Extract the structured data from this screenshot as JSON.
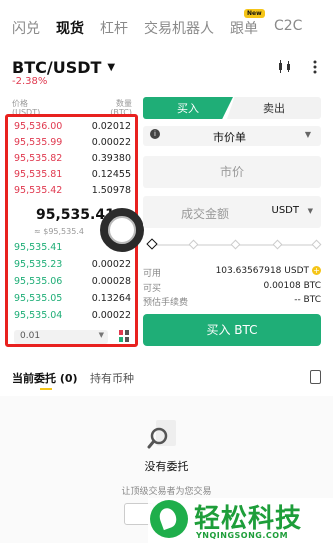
{
  "top_tabs": [
    {
      "label": "闪兑",
      "active": false
    },
    {
      "label": "现货",
      "active": true
    },
    {
      "label": "杠杆",
      "active": false
    },
    {
      "label": "交易机器人",
      "active": false
    },
    {
      "label": "跟单",
      "active": false,
      "badge": "New"
    },
    {
      "label": "C2C",
      "active": false
    }
  ],
  "pair": {
    "name": "BTC/USDT",
    "change": "-2.38%"
  },
  "orderbook": {
    "price_header": "价格",
    "price_unit": "(USDT)",
    "qty_header": "数量",
    "qty_unit": "(BTC)",
    "asks": [
      {
        "price": "95,536.00",
        "qty": "0.02012"
      },
      {
        "price": "95,535.99",
        "qty": "0.00022"
      },
      {
        "price": "95,535.82",
        "qty": "0.39380"
      },
      {
        "price": "95,535.81",
        "qty": "0.12455"
      },
      {
        "price": "95,535.42",
        "qty": "1.50978"
      }
    ],
    "last_price": "95,535.41",
    "last_price_fiat": "≈ $95,535.4",
    "bids": [
      {
        "price": "95,535.41",
        "qty": "1."
      },
      {
        "price": "95,535.23",
        "qty": "0.00022"
      },
      {
        "price": "95,535.06",
        "qty": "0.00028"
      },
      {
        "price": "95,535.05",
        "qty": "0.13264"
      },
      {
        "price": "95,535.04",
        "qty": "0.00022"
      }
    ],
    "precision": "0.01"
  },
  "trade": {
    "buy_tab": "买入",
    "sell_tab": "卖出",
    "order_type": "市价单",
    "price_placeholder": "市价",
    "amount_placeholder": "成交金额",
    "amount_unit": "USDT",
    "available_label": "可用",
    "available_value": "103.63567918 USDT",
    "can_buy_label": "可买",
    "can_buy_value": "0.00108 BTC",
    "fee_label": "预估手续费",
    "fee_value": "-- BTC",
    "buy_button": "买入 BTC"
  },
  "orders": {
    "tab_current": "当前委托 (0)",
    "tab_holdings": "持有币种",
    "empty_title": "没有委托",
    "empty_subtitle": "让顶级交易者为您交易"
  },
  "watermark": {
    "text": "轻松科技",
    "sub": "YNQINGSONG.COM"
  },
  "colors": {
    "buy": "#1fae77",
    "sell": "#e0394f",
    "highlight": "#e8211f",
    "accent": "#f5c518"
  }
}
